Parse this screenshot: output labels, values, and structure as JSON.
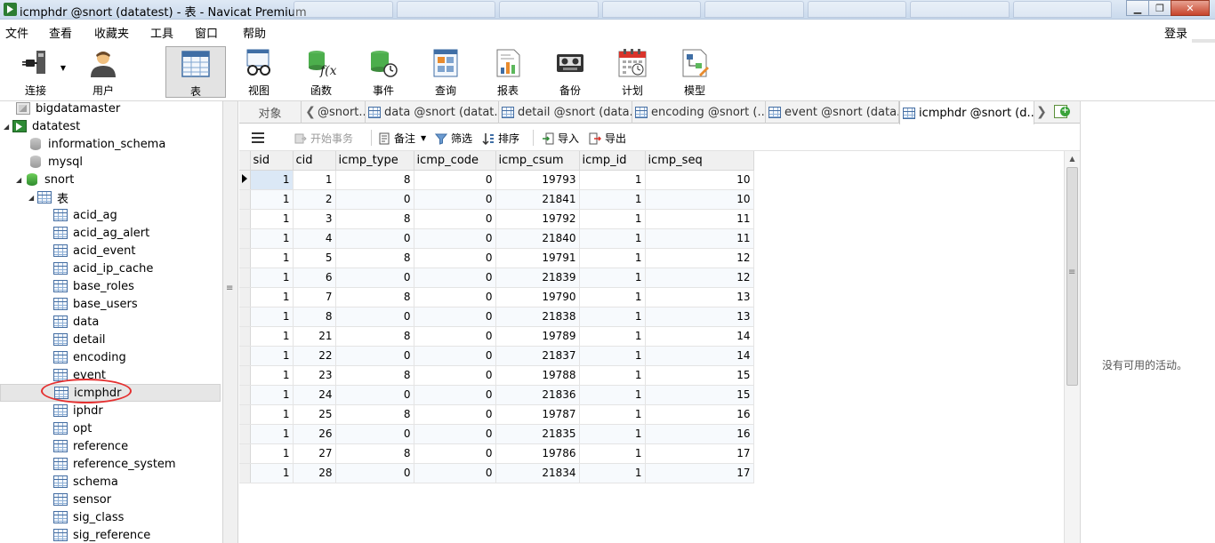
{
  "window": {
    "title": "icmphdr @snort (datatest) - 表 - Navicat Premium",
    "controls": {
      "minimize": "▁",
      "maximize": "❐",
      "close": "✕"
    }
  },
  "menu": {
    "items": [
      "文件",
      "查看",
      "收藏夹",
      "工具",
      "窗口",
      "帮助"
    ],
    "login": "登录"
  },
  "toolbar": {
    "buttons": [
      {
        "label": "连接",
        "icon": "plug-connection-icon"
      },
      {
        "label": "用户",
        "icon": "user-icon"
      },
      {
        "label": "表",
        "icon": "table-icon",
        "active": true
      },
      {
        "label": "视图",
        "icon": "view-glasses-icon"
      },
      {
        "label": "函数",
        "icon": "function-fx-icon"
      },
      {
        "label": "事件",
        "icon": "event-clock-icon"
      },
      {
        "label": "查询",
        "icon": "query-icon"
      },
      {
        "label": "报表",
        "icon": "report-chart-icon"
      },
      {
        "label": "备份",
        "icon": "backup-tape-icon"
      },
      {
        "label": "计划",
        "icon": "schedule-calendar-icon"
      },
      {
        "label": "模型",
        "icon": "model-diagram-icon"
      }
    ]
  },
  "tree": {
    "connections": [
      {
        "label": "bigdatamaster"
      },
      {
        "label": "datatest"
      }
    ],
    "databases": [
      "information_schema",
      "mysql",
      "snort"
    ],
    "tables_folder": "表",
    "tables": [
      "acid_ag",
      "acid_ag_alert",
      "acid_event",
      "acid_ip_cache",
      "base_roles",
      "base_users",
      "data",
      "detail",
      "encoding",
      "event",
      "icmphdr",
      "iphdr",
      "opt",
      "reference",
      "reference_system",
      "schema",
      "sensor",
      "sig_class",
      "sig_reference"
    ],
    "selected": "icmphdr"
  },
  "tabs": {
    "objects": "对象",
    "items": [
      "@snort...",
      "data @snort (datat...",
      "detail @snort (data...",
      "encoding @snort (...",
      "event @snort (data...",
      "icmphdr @snort (d..."
    ]
  },
  "datatools": {
    "begin_transaction": "开始事务",
    "memo": "备注",
    "filter": "筛选",
    "sort": "排序",
    "import": "导入",
    "export": "导出"
  },
  "grid": {
    "columns": [
      "sid",
      "cid",
      "icmp_type",
      "icmp_code",
      "icmp_csum",
      "icmp_id",
      "icmp_seq"
    ],
    "rows": [
      [
        "1",
        "1",
        "8",
        "0",
        "19793",
        "1",
        "10"
      ],
      [
        "1",
        "2",
        "0",
        "0",
        "21841",
        "1",
        "10"
      ],
      [
        "1",
        "3",
        "8",
        "0",
        "19792",
        "1",
        "11"
      ],
      [
        "1",
        "4",
        "0",
        "0",
        "21840",
        "1",
        "11"
      ],
      [
        "1",
        "5",
        "8",
        "0",
        "19791",
        "1",
        "12"
      ],
      [
        "1",
        "6",
        "0",
        "0",
        "21839",
        "1",
        "12"
      ],
      [
        "1",
        "7",
        "8",
        "0",
        "19790",
        "1",
        "13"
      ],
      [
        "1",
        "8",
        "0",
        "0",
        "21838",
        "1",
        "13"
      ],
      [
        "1",
        "21",
        "8",
        "0",
        "19789",
        "1",
        "14"
      ],
      [
        "1",
        "22",
        "0",
        "0",
        "21837",
        "1",
        "14"
      ],
      [
        "1",
        "23",
        "8",
        "0",
        "19788",
        "1",
        "15"
      ],
      [
        "1",
        "24",
        "0",
        "0",
        "21836",
        "1",
        "15"
      ],
      [
        "1",
        "25",
        "8",
        "0",
        "19787",
        "1",
        "16"
      ],
      [
        "1",
        "26",
        "0",
        "0",
        "21835",
        "1",
        "16"
      ],
      [
        "1",
        "27",
        "8",
        "0",
        "19786",
        "1",
        "17"
      ],
      [
        "1",
        "28",
        "0",
        "0",
        "21834",
        "1",
        "17"
      ]
    ]
  },
  "info_panel": {
    "message": "没有可用的活动。"
  },
  "colors": {
    "accent_green": "#2e8b35",
    "selection_blue": "#dbe8f6",
    "highlight_red": "#e53030"
  }
}
